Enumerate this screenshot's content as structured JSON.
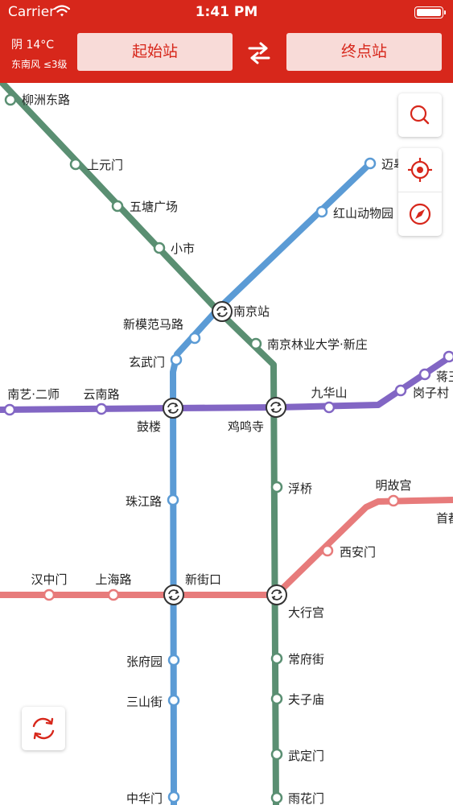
{
  "status_bar": {
    "carrier": "Carrier",
    "time": "1:41 PM"
  },
  "weather": {
    "condition": "阴 14°C",
    "wind": "东南风 ≤3级"
  },
  "route": {
    "start_label": "起始站",
    "end_label": "终点站"
  },
  "colors": {
    "header": "#d7271b",
    "line1": "#5b9bd5",
    "line3": "#5a8f72",
    "line2": "#e77b7b",
    "line4": "#8266c4"
  },
  "icons": [
    "wifi-icon",
    "battery-icon",
    "swap-icon",
    "search-icon",
    "locate-icon",
    "compass-icon",
    "refresh-icon",
    "transfer-icon"
  ],
  "stations": {
    "liuzhou_donglu": "柳洲东路",
    "shangyuanmen": "上元门",
    "wutang_guangchang": "五塘广场",
    "xiaoshi": "小市",
    "nanjing_zhan": "南京站",
    "nanjing_linye": "南京林业大学·新庄",
    "maigaoqiao": "迈皋",
    "hongshan": "红山动物园",
    "xinmofan": "新模范马路",
    "xuanwumen": "玄武门",
    "nanyi": "南艺·二师",
    "yunnanlu": "云南路",
    "gulou": "鼓楼",
    "jimingsi": "鸡鸣寺",
    "jiuhuashan": "九华山",
    "gangzicun": "岗子村",
    "jiangwang": "蒋王",
    "zhujianglu": "珠江路",
    "fuqiao": "浮桥",
    "minggugong": "明故宫",
    "xianmen": "西安门",
    "shoujing": "首都",
    "hanzhongmen": "汉中门",
    "shanghailu": "上海路",
    "xinjiekou": "新街口",
    "daxinggong": "大行宫",
    "zhangfuyuan": "张府园",
    "changfujie": "常府街",
    "sanshanjie": "三山街",
    "fuzimiao": "夫子庙",
    "wudingmen": "武定门",
    "zhonghuamen": "中华门",
    "yuhuamen": "雨花门"
  }
}
